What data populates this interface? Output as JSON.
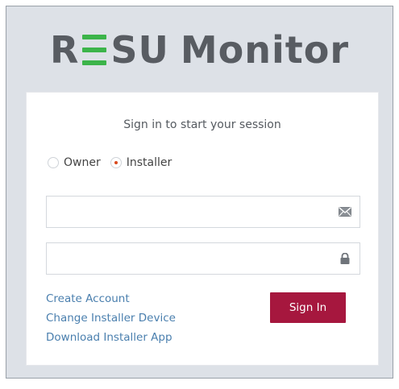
{
  "logo": {
    "brand_r": "R",
    "brand_su": "SU",
    "brand_monitor": "Monitor"
  },
  "login": {
    "subtitle": "Sign in to start your session",
    "roles": [
      {
        "label": "Owner",
        "selected": false
      },
      {
        "label": "Installer",
        "selected": true
      }
    ],
    "username_value": "",
    "password_value": "",
    "sign_in_label": "Sign In",
    "links": [
      "Create Account",
      "Change Installer Device",
      "Download Installer App"
    ]
  },
  "colors": {
    "accent_green": "#3cb44a",
    "sign_in_button": "#a6173e",
    "link": "#4a7fae",
    "selected_radio": "#d94a1e"
  },
  "icons": {
    "username_field": "envelope-icon",
    "password_field": "lock-icon"
  }
}
